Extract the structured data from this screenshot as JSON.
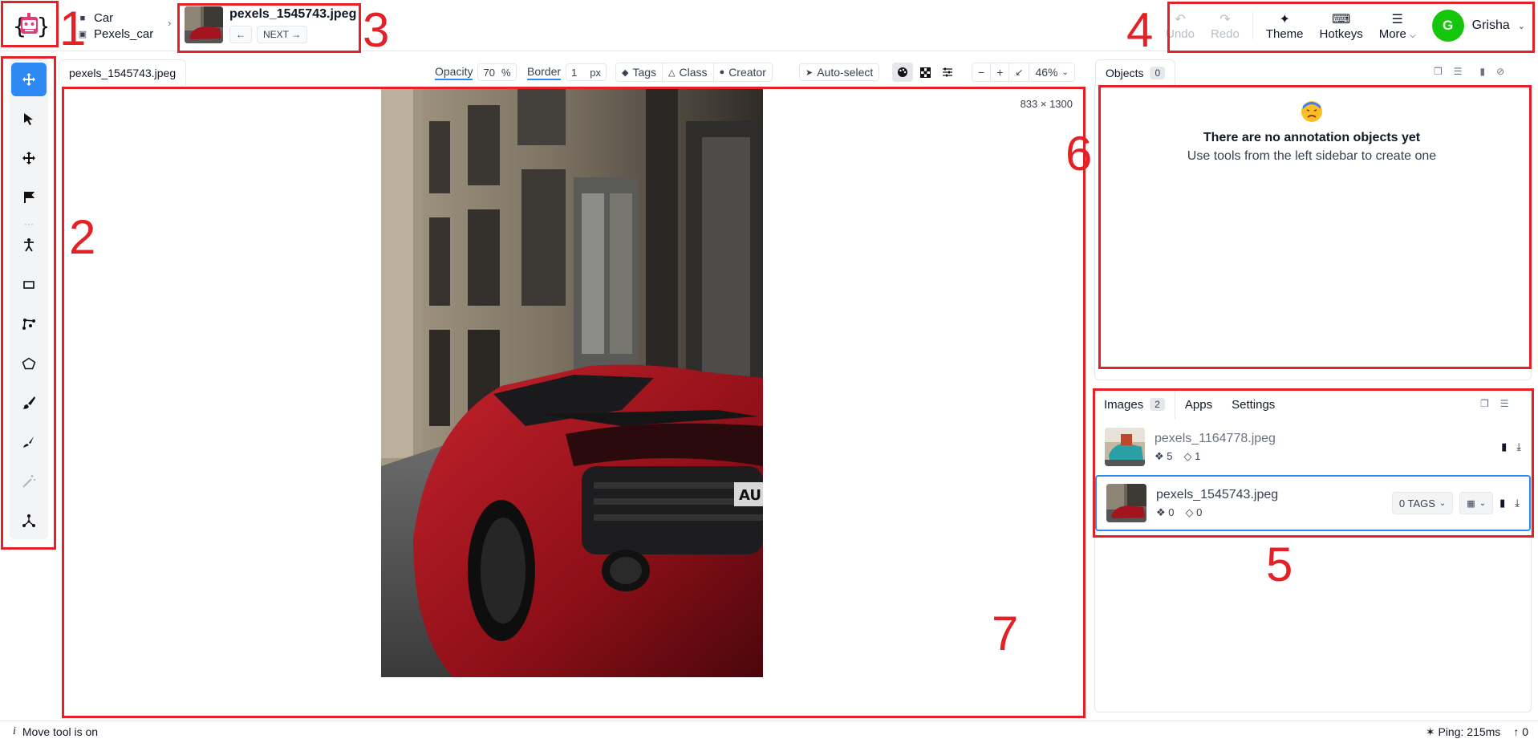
{
  "breadcrumb": {
    "project": "Car",
    "dataset": "Pexels_car"
  },
  "current_image": {
    "name": "pexels_1545743.jpeg",
    "prev_label": "←",
    "next_label": "NEXT →"
  },
  "header_actions": {
    "undo": "Undo",
    "redo": "Redo",
    "theme": "Theme",
    "hotkeys": "Hotkeys",
    "more": "More",
    "user_initial": "G",
    "user_name": "Grisha"
  },
  "canvas_toolbar": {
    "tab_name": "pexels_1545743.jpeg",
    "opacity_label": "Opacity",
    "opacity_value": "70",
    "opacity_unit": "%",
    "border_label": "Border",
    "border_value": "1",
    "border_unit": "px",
    "tags": "Tags",
    "class": "Class",
    "creator": "Creator",
    "auto_select": "Auto-select",
    "zoom_minus": "−",
    "zoom_plus": "+",
    "zoom": "46%"
  },
  "canvas": {
    "dimensions": "833 × 1300"
  },
  "objects_panel": {
    "tab": "Objects",
    "count": "0",
    "empty_title": "There are no annotation objects yet",
    "empty_hint": "Use tools from the left sidebar to create one"
  },
  "images_panel": {
    "tabs": [
      {
        "label": "Images",
        "count": "2"
      },
      {
        "label": "Apps"
      },
      {
        "label": "Settings"
      }
    ],
    "items": [
      {
        "name": "pexels_1164778.jpeg",
        "objects": "5",
        "tags": "1"
      },
      {
        "name": "pexels_1545743.jpeg",
        "objects": "0",
        "tags": "0",
        "tag_button": "0 TAGS"
      }
    ]
  },
  "status": {
    "message": "Move tool is on",
    "ping": "Ping: 215ms",
    "uploads": "0"
  },
  "annotations": {
    "n1": "1",
    "n2": "2",
    "n3": "3",
    "n4": "4",
    "n5": "5",
    "n6": "6",
    "n7": "7"
  },
  "colors": {
    "accent": "#2f89f5",
    "annotation_red": "#e52128",
    "avatar": "#16c60c",
    "logo_pink": "#e33e73"
  }
}
